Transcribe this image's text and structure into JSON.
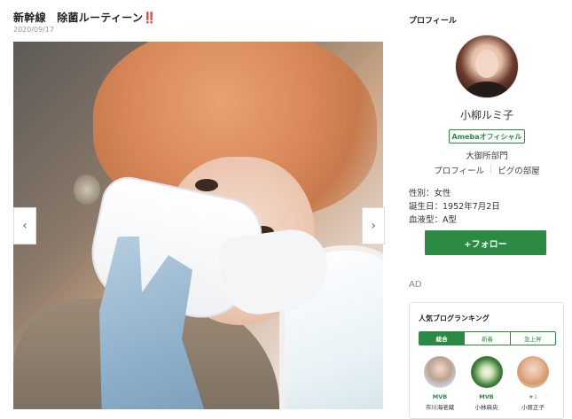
{
  "post": {
    "title": "新幹線　除菌ルーティーン",
    "title_emoji": "‼️",
    "date": "2020/09/17",
    "prev_label": "‹",
    "next_label": "›"
  },
  "sidebar": {
    "heading": "プロフィール",
    "name": "小柳ルミ子",
    "badge": "Amebaオフィシャル",
    "category": "大御所部門",
    "links": [
      "プロフィール",
      "ピグの部屋"
    ],
    "gender": "性別：女性",
    "birthday": "誕生日：1952年7月2日",
    "blood_type": "血液型：A型",
    "follow_label": "+フォロー",
    "ad_label": "AD"
  },
  "ranking": {
    "title": "人気ブログランキング",
    "tabs": [
      "総合",
      "新着",
      "急上昇"
    ],
    "active_tab": "総合",
    "items": [
      {
        "badge": "MVB",
        "name": "市川海老蔵"
      },
      {
        "badge": "MVB",
        "name": "小林麻央"
      },
      {
        "badge": "★1",
        "name": "小原正子"
      }
    ]
  },
  "colors": {
    "accent": "#2d8a45",
    "title_emphasis": "#d22222"
  }
}
